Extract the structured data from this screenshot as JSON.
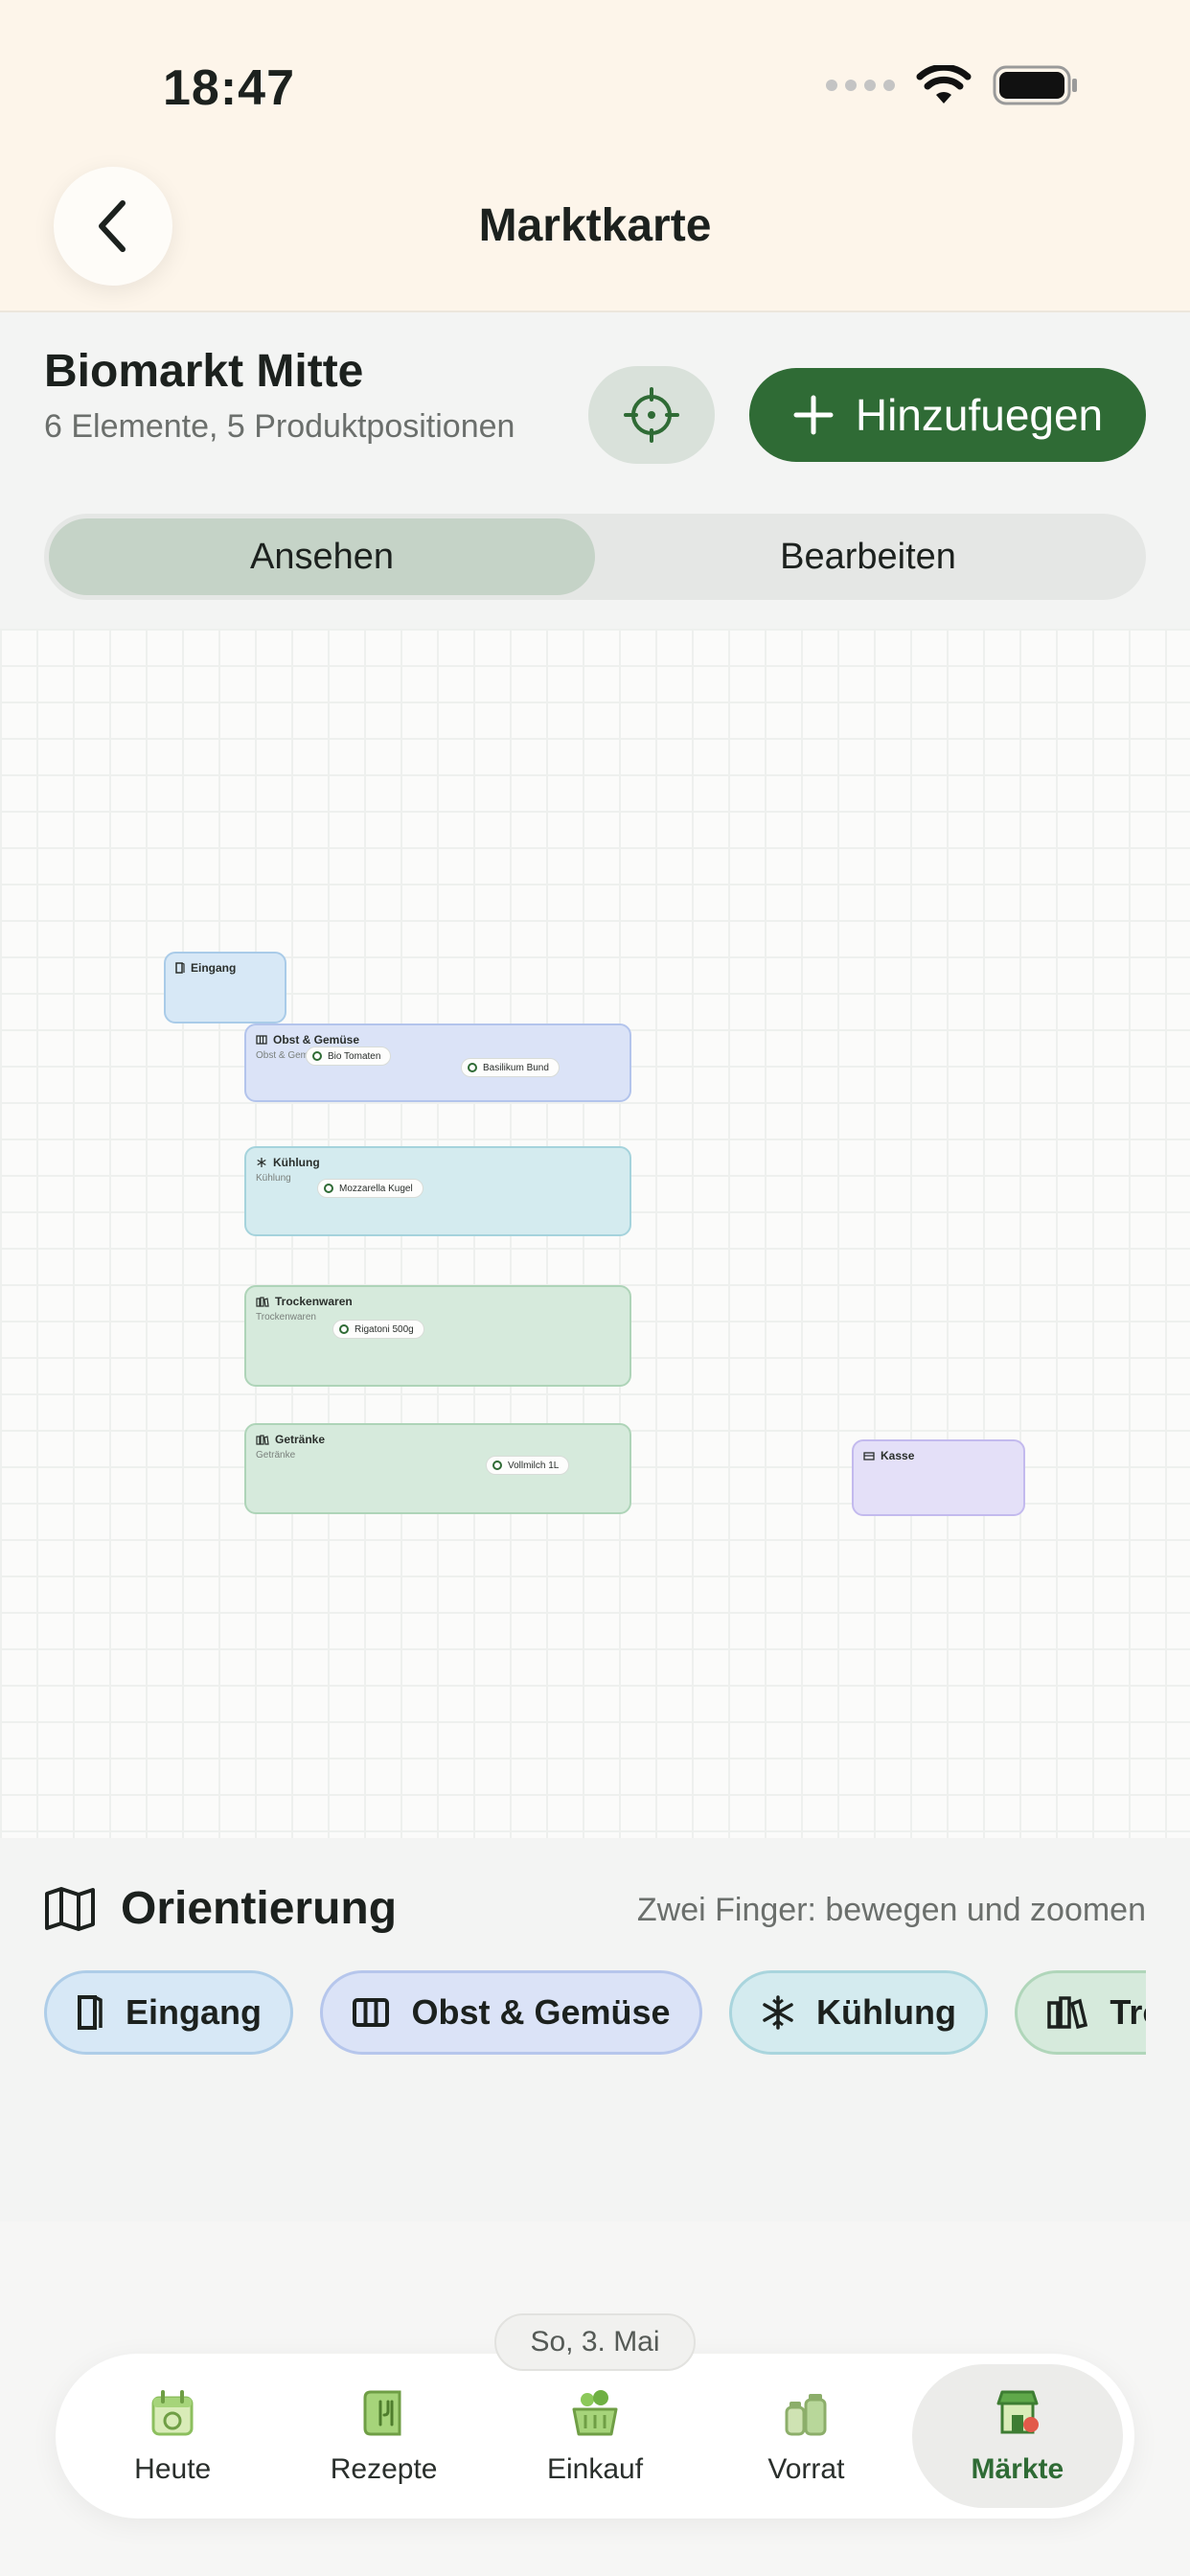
{
  "status": {
    "time": "18:47"
  },
  "header": {
    "title": "Marktkarte"
  },
  "market": {
    "name": "Biomarkt Mitte",
    "subtitle": "6 Elemente, 5 Produktpositionen",
    "add_label": "Hinzufuegen",
    "segments": [
      "Ansehen",
      "Bearbeiten"
    ],
    "active_segment": "Ansehen"
  },
  "map": {
    "zones": [
      {
        "title": "Eingang",
        "sub": "",
        "icon": "door-icon",
        "color": "#d7e8f6"
      },
      {
        "title": "Obst & Gemüse",
        "sub": "Obst & Gem",
        "icon": "shelf-icon",
        "color": "#dbe3f7"
      },
      {
        "title": "Kühlung",
        "sub": "Kühlung",
        "icon": "snowflake-icon",
        "color": "#d4ebef"
      },
      {
        "title": "Trockenwaren",
        "sub": "Trockenwaren",
        "icon": "books-icon",
        "color": "#d6eadc"
      },
      {
        "title": "Getränke",
        "sub": "Getränke",
        "icon": "books-icon",
        "color": "#d6eadc"
      },
      {
        "title": "Kasse",
        "sub": "",
        "icon": "register-icon",
        "color": "#e4e0f8"
      }
    ],
    "products": [
      "Bio Tomaten",
      "Basilikum Bund",
      "Mozzarella Kugel",
      "Rigatoni 500g",
      "Vollmilch 1L"
    ]
  },
  "orientation": {
    "title": "Orientierung",
    "hint": "Zwei Finger: bewegen und zoomen",
    "chips": [
      {
        "label": "Eingang",
        "icon": "door-icon"
      },
      {
        "label": "Obst & Gemüse",
        "icon": "shelf-icon"
      },
      {
        "label": "Kühlung",
        "icon": "snowflake-icon"
      },
      {
        "label": "Trockenwaren",
        "icon": "books-icon"
      }
    ]
  },
  "date_label": "So, 3. Mai",
  "tabs": [
    {
      "label": "Heute",
      "icon": "calendar-icon"
    },
    {
      "label": "Rezepte",
      "icon": "recipe-book-icon"
    },
    {
      "label": "Einkauf",
      "icon": "basket-icon"
    },
    {
      "label": "Vorrat",
      "icon": "jars-icon"
    },
    {
      "label": "Märkte",
      "icon": "market-icon"
    }
  ],
  "active_tab": "Märkte"
}
